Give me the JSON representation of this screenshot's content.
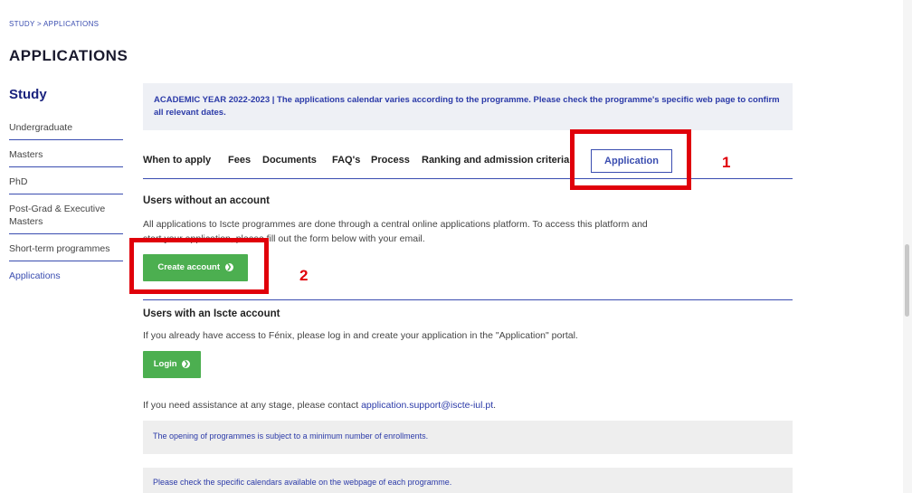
{
  "breadcrumb": "STUDY > APPLICATIONS",
  "page_title": "APPLICATIONS",
  "sidebar": {
    "title": "Study",
    "items": [
      {
        "label": "Undergraduate"
      },
      {
        "label": "Masters"
      },
      {
        "label": "PhD"
      },
      {
        "label": "Post-Grad & Executive Masters"
      },
      {
        "label": "Short-term programmes"
      },
      {
        "label": "Applications"
      }
    ]
  },
  "notice": "ACADEMIC YEAR 2022-2023   |   The applications calendar varies according to the programme. Please check the programme's specific web page to confirm all relevant dates.",
  "tabs": [
    "When to apply",
    "Fees",
    "Documents",
    "FAQ's",
    "Process",
    "Ranking and admission criteria",
    "Application"
  ],
  "annotations": {
    "one": "1",
    "two": "2",
    "color": "#e0000a"
  },
  "no_account": {
    "heading": "Users without an account",
    "text_line1": "All applications to Iscte programmes are done through a central online applications platform. To access this platform and",
    "text_line2": "start your application, please fill out the form below with your email.",
    "button": "Create account"
  },
  "with_account": {
    "heading": "Users with an Iscte account",
    "text": "If you already have access to Fénix, please log in and create your application in the \"Application\" portal.",
    "button": "Login"
  },
  "assistance": {
    "text": "If you need assistance at any stage, please contact ",
    "email": "application.support@iscte-iul.pt",
    "suffix": "."
  },
  "info_boxes": [
    "The opening of programmes is subject to a minimum number of enrollments.",
    "Please check the specific calendars available on the webpage of each programme."
  ],
  "colors": {
    "accent": "#3a4db0",
    "button": "#4caf50",
    "highlight": "#e0000a"
  },
  "icons": {
    "button_arrow": "chevron-circle-right-icon"
  }
}
